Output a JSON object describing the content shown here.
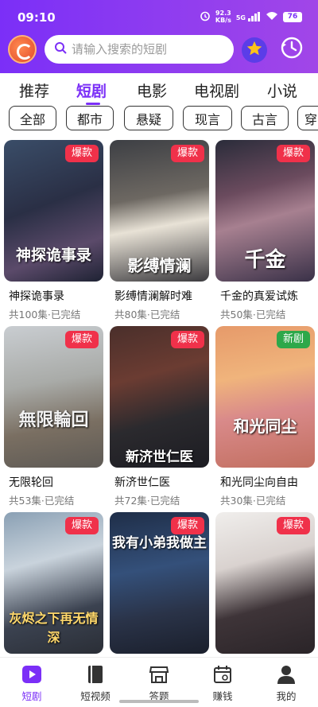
{
  "status": {
    "time": "09:10",
    "speed_value": "92.3",
    "speed_unit": "KB/s",
    "network": "5G",
    "battery": "76"
  },
  "search": {
    "placeholder": "请输入搜索的短剧"
  },
  "tabs": [
    {
      "label": "推荐"
    },
    {
      "label": "短剧"
    },
    {
      "label": "电影"
    },
    {
      "label": "电视剧"
    },
    {
      "label": "小说"
    }
  ],
  "active_tab": "短剧",
  "chips": [
    {
      "label": "全部"
    },
    {
      "label": "都市"
    },
    {
      "label": "悬疑"
    },
    {
      "label": "现言"
    },
    {
      "label": "古言"
    },
    {
      "label": "穿"
    }
  ],
  "dramas": [
    {
      "title": "神探诡事录",
      "meta": "共100集·已完结",
      "badge": "爆款",
      "poster_text": "神探诡事录"
    },
    {
      "title": "影缚情澜解时难",
      "meta": "共80集·已完结",
      "badge": "爆款",
      "poster_text": "影缚情澜"
    },
    {
      "title": "千金的真爱试炼",
      "meta": "共50集·已完结",
      "badge": "爆款",
      "poster_text": "千金"
    },
    {
      "title": "无限轮回",
      "meta": "共53集·已完结",
      "badge": "爆款",
      "poster_text": "無限輪回"
    },
    {
      "title": "新济世仁医",
      "meta": "共72集·已完结",
      "badge": "爆款",
      "poster_text": "新济世仁医"
    },
    {
      "title": "和光同尘向自由",
      "meta": "共30集·已完结",
      "badge": "新剧",
      "poster_text": "和光同尘"
    },
    {
      "title": "",
      "meta": "",
      "badge": "爆款",
      "poster_text": "灰烬之下再无情深"
    },
    {
      "title": "",
      "meta": "",
      "badge": "爆款",
      "poster_text": "我有小弟我做主"
    },
    {
      "title": "",
      "meta": "",
      "badge": "爆款",
      "poster_text": ""
    }
  ],
  "bottom_nav": [
    {
      "label": "短剧",
      "icon": "play-icon"
    },
    {
      "label": "短视频",
      "icon": "book-icon"
    },
    {
      "label": "答题",
      "icon": "store-icon"
    },
    {
      "label": "赚钱",
      "icon": "calendar-icon"
    },
    {
      "label": "我的",
      "icon": "person-icon"
    }
  ],
  "colors": {
    "accent": "#7b2ff7",
    "hot_badge": "#f0314a",
    "new_badge": "#2ea84a"
  }
}
